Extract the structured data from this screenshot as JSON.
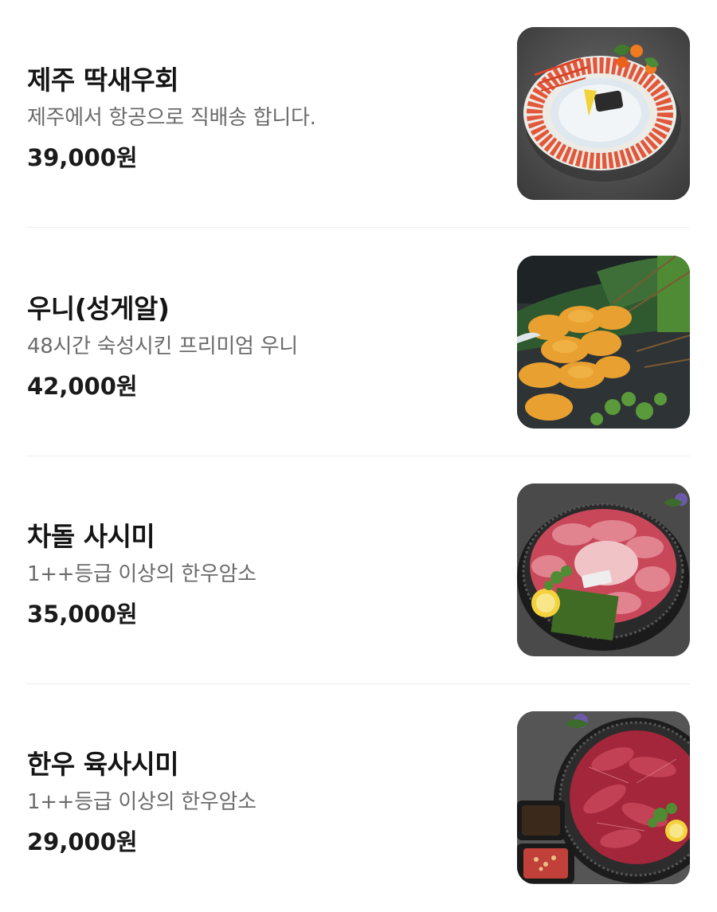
{
  "menu": {
    "items": [
      {
        "name": "제주 딱새우회",
        "description": "제주에서 항공으로 직배송 합니다.",
        "price": "39,000원",
        "image_alt": "jeju-shrimp-sashimi-photo"
      },
      {
        "name": "우니(성게알)",
        "description": "48시간 숙성시킨 프리미엄 우니",
        "price": "42,000원",
        "image_alt": "sea-urchin-photo"
      },
      {
        "name": "차돌 사시미",
        "description": "1++등급 이상의 한우암소",
        "price": "35,000원",
        "image_alt": "brisket-sashimi-photo"
      },
      {
        "name": "한우 육사시미",
        "description": "1++등급 이상의 한우암소",
        "price": "29,000원",
        "image_alt": "hanwoo-yuk-sashimi-photo"
      }
    ]
  }
}
